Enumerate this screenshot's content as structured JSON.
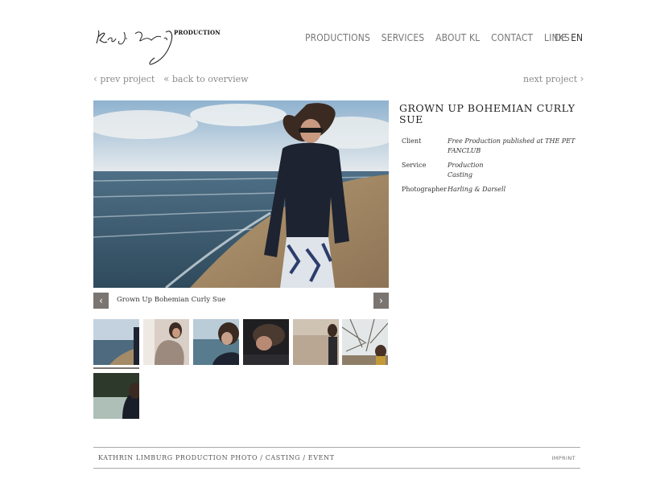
{
  "header": {
    "logo_text": "PRODUCTION",
    "nav": [
      "PRODUCTIONS",
      "SERVICES",
      "ABOUT KL",
      "CONTACT",
      "LINKS"
    ],
    "languages": [
      "DE",
      "EN"
    ],
    "active_language": "EN"
  },
  "pager": {
    "prev_label": "prev project",
    "back_label": "back to overview",
    "next_label": "next project"
  },
  "project": {
    "title": "GROWN UP BOHEMIAN CURLY SUE",
    "caption": "Grown Up Bohemian Curly Sue",
    "details": [
      {
        "label": "Client",
        "value": "Free Production published at THE PET FANCLUB"
      },
      {
        "label": "Service",
        "value": "Production\nCasting"
      },
      {
        "label": "Photographer",
        "value": "Harling & Darsell"
      }
    ]
  },
  "gallery": {
    "thumbnail_count": 7,
    "active_index": 0
  },
  "footer": {
    "text": "KATHRIN LIMBURG PRODUCTION PHOTO / CASTING / EVENT",
    "imprint": "IMPRINT"
  },
  "colors": {
    "button_bg": "#7a7570",
    "nav_text": "#777777",
    "rule": "#aaaaaa"
  }
}
